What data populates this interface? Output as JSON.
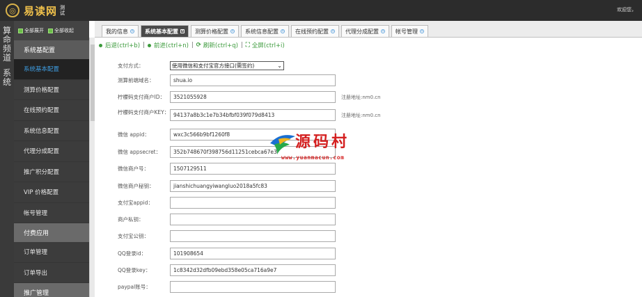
{
  "header": {
    "logo_glyph": "◎",
    "site_name": "易读网",
    "site_sub": "测试",
    "welcome": "欢迎您，"
  },
  "vstrip": {
    "text1": [
      "算",
      "命",
      "频",
      "道"
    ],
    "text2": [
      "系",
      "统"
    ]
  },
  "sidebar": {
    "expand_all": "全部展开",
    "collapse_all": "全部收起",
    "groups": [
      {
        "label": "系统基配置"
      },
      {
        "label": "付费应用"
      },
      {
        "label": "推广管理"
      }
    ],
    "items_a": [
      {
        "label": "系统基本配置",
        "active": true
      },
      {
        "label": "测算价格配置"
      },
      {
        "label": "在线预约配置"
      },
      {
        "label": "系统信息配置"
      },
      {
        "label": "代理分成配置"
      },
      {
        "label": "推广积分配置"
      },
      {
        "label": "VIP 价格配置"
      },
      {
        "label": "帐号管理"
      }
    ],
    "items_b": [
      {
        "label": "订单管理"
      },
      {
        "label": "订单导出"
      }
    ]
  },
  "tabs": [
    {
      "label": "我的信息"
    },
    {
      "label": "系统基本配置",
      "active": true
    },
    {
      "label": "测算价格配置"
    },
    {
      "label": "系统信息配置"
    },
    {
      "label": "在线预约配置"
    },
    {
      "label": "代理分成配置"
    },
    {
      "label": "帐号管理"
    }
  ],
  "toolbar": {
    "back": "后退(ctrl+b)",
    "forward": "前进(ctrl+n)",
    "refresh": "刷新(ctrl+q)",
    "fullscreen": "全屏(ctrl+i)"
  },
  "form": {
    "rows": [
      {
        "label": "支付方式：",
        "type": "select",
        "value": "使用微信和支付宝官方接口(需签约)"
      },
      {
        "label": "测算前端域名：",
        "value": "shua.io"
      },
      {
        "label": "柠檬码支付商户ID：",
        "value": "3521055928",
        "note": "注册地址:nm0.cn"
      },
      {
        "label": "柠檬码支付商户KEY：",
        "value": "94137a8b3c1e7b34bfbf039f079d8413",
        "note": "注册地址:nm0.cn"
      },
      {
        "label": "微信 appid：",
        "value": "wxc3c566b9bf1260f8"
      },
      {
        "label": "微信 appsecret：",
        "value": "352b748670f398756d11251cebca67e3"
      },
      {
        "label": "微信商户号：",
        "value": "1507129511"
      },
      {
        "label": "微信商户秘钥：",
        "value": "jianshichuangyiwangluo2018a5fc83"
      },
      {
        "label": "支付宝appid：",
        "value": ""
      },
      {
        "label": "商户私钥：",
        "value": ""
      },
      {
        "label": "支付宝公钥：",
        "value": ""
      },
      {
        "label": "QQ登录id：",
        "value": "101908654"
      },
      {
        "label": "QQ登录key：",
        "value": "1c8342d32dfb09ebd358e05ca716a9e7"
      },
      {
        "label": "paypal账号：",
        "value": ""
      }
    ]
  },
  "watermark": {
    "text": "源码村",
    "url": "www.yuanmacun.com"
  }
}
